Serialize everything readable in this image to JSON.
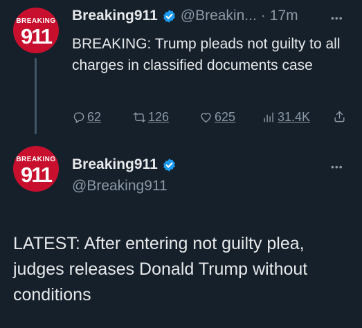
{
  "tweet1": {
    "avatar_top": "BREAKING",
    "avatar_num": "911",
    "name": "Breaking911",
    "handle": "@Breakin...",
    "separator": "·",
    "time": "17m",
    "more": "•••",
    "text": "BREAKING: Trump pleads not guilty to all charges in classified documents case",
    "actions": {
      "replies": "62",
      "retweets": "126",
      "likes": "625",
      "views": "31.4K"
    }
  },
  "tweet2": {
    "avatar_top": "BREAKING",
    "avatar_num": "911",
    "name": "Breaking911",
    "handle": "@Breaking911",
    "more": "•••",
    "text": "LATEST: After entering not guilty plea, judges releases Donald Trump without conditions"
  },
  "colors": {
    "background": "#15202b",
    "text": "#e7e9ea",
    "muted": "#8b98a5",
    "verified": "#1d9bf0",
    "avatar": "#c8102e"
  },
  "icons": {
    "reply": "reply-icon",
    "retweet": "retweet-icon",
    "like": "heart-icon",
    "views": "views-icon",
    "share": "share-icon",
    "verified": "verified-badge-icon"
  }
}
